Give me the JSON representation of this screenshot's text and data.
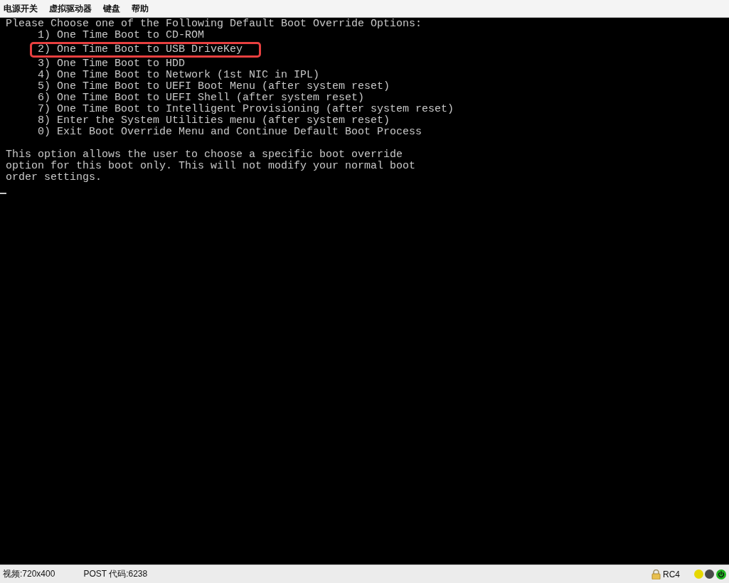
{
  "menu": [
    "电源开关",
    "虚拟驱动器",
    "键盘",
    "帮助"
  ],
  "console": {
    "heading": "Please Choose one of the Following Default Boot Override Options:",
    "options": [
      {
        "text": "1) One Time Boot to CD-ROM",
        "highlighted": false
      },
      {
        "text": "2) One Time Boot to USB DriveKey",
        "highlighted": true
      },
      {
        "text": "3) One Time Boot to HDD",
        "highlighted": false
      },
      {
        "text": "4) One Time Boot to Network (1st NIC in IPL)",
        "highlighted": false
      },
      {
        "text": "5) One Time Boot to UEFI Boot Menu (after system reset)",
        "highlighted": false
      },
      {
        "text": "6) One Time Boot to UEFI Shell (after system reset)",
        "highlighted": false
      },
      {
        "text": "7) One Time Boot to Intelligent Provisioning (after system reset)",
        "highlighted": false
      },
      {
        "text": "8) Enter the System Utilities menu (after system reset)",
        "highlighted": false
      },
      {
        "text": "0) Exit Boot Override Menu and Continue Default Boot Process",
        "highlighted": false
      }
    ],
    "description": [
      "This option allows the user to choose a specific boot override",
      "option for this boot only. This will not modify your normal boot",
      "order settings."
    ],
    "cursor": true
  },
  "status_bar": {
    "video": "视频:720x400",
    "post_code": "POST 代码:6238",
    "encryption": "RC4",
    "indicators": [
      {
        "color": "#e6d800",
        "kind": "dot"
      },
      {
        "color": "#4a4a4a",
        "kind": "dot"
      },
      {
        "color": "#22b422",
        "kind": "power"
      }
    ]
  }
}
